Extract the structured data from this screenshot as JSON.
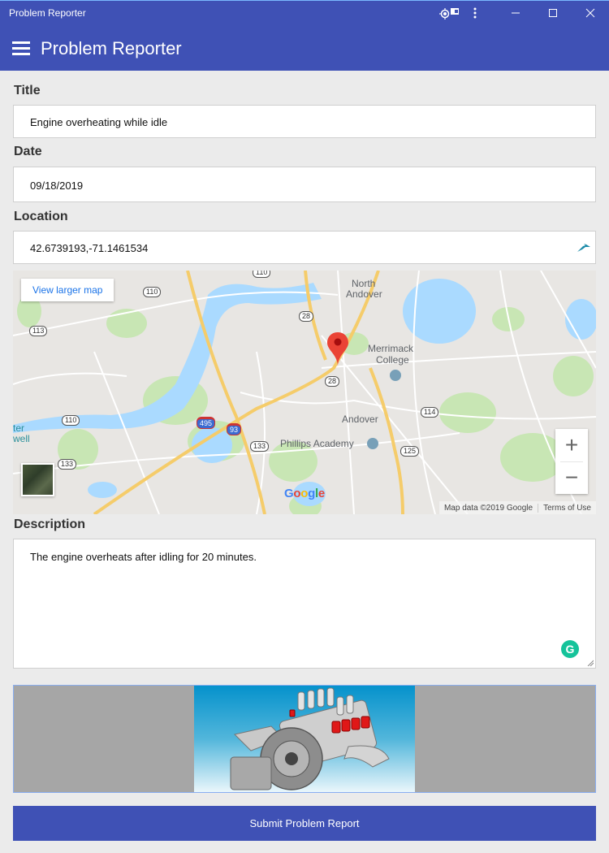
{
  "window": {
    "title": "Problem Reporter",
    "controls": {
      "location_icon": "location-target-icon",
      "cast_icon": "cast-window-icon",
      "more_icon": "more-vertical-icon",
      "minimize_icon": "minimize-icon",
      "maximize_icon": "maximize-icon",
      "close_icon": "close-icon"
    }
  },
  "appbar": {
    "menu_icon": "hamburger-menu-icon",
    "title": "Problem Reporter"
  },
  "form": {
    "title": {
      "label": "Title",
      "value": "Engine overheating while idle"
    },
    "date": {
      "label": "Date",
      "value": "09/18/2019"
    },
    "location": {
      "label": "Location",
      "value": "42.6739193,-71.1461534",
      "icon": "location-gazelle-icon"
    },
    "map": {
      "view_larger": "View larger map",
      "zoom_in": "+",
      "zoom_out": "−",
      "attribution": "Map data ©2019 Google",
      "terms": "Terms of Use",
      "logo": [
        "G",
        "o",
        "o",
        "g",
        "l",
        "e"
      ],
      "logo_colors": [
        "#4285f4",
        "#ea4335",
        "#fbbc05",
        "#4285f4",
        "#34a853",
        "#ea4335"
      ],
      "places": {
        "north_andover_1": "North",
        "north_andover_2": "Andover",
        "merrimack_1": "Merrimack",
        "merrimack_2": "College",
        "andover": "Andover",
        "phillips": "Phillips Academy",
        "lowell_1": "ter",
        "lowell_2": "well"
      },
      "route_shields": [
        "110",
        "110",
        "113",
        "28",
        "28",
        "110",
        "114",
        "133",
        "133",
        "125",
        "495",
        "93"
      ],
      "marker_color": "#ea4335"
    },
    "description": {
      "label": "Description",
      "value": "The engine overheats after idling for 20 minutes."
    },
    "submit_label": "Submit Problem Report"
  },
  "colors": {
    "primary": "#3f51b5",
    "background": "#ebebeb",
    "grammarly": "#15c39a"
  }
}
